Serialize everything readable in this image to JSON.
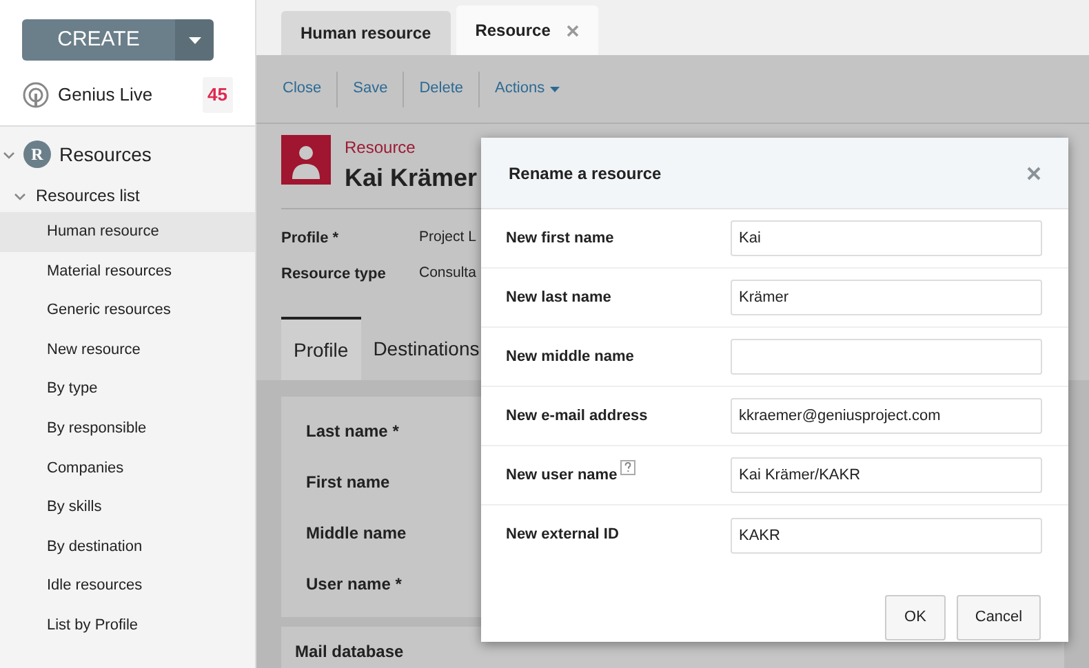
{
  "sidebar": {
    "create_label": "CREATE",
    "live": {
      "label": "Genius Live",
      "count": "45"
    },
    "section": {
      "letter": "R",
      "label": "Resources",
      "expanded": true,
      "group": {
        "label": "Resources list",
        "expanded": true,
        "items": [
          {
            "label": "Human resource",
            "selected": true
          },
          {
            "label": "Material resources",
            "selected": false
          },
          {
            "label": "Generic resources",
            "selected": false
          },
          {
            "label": "New resource",
            "selected": false
          },
          {
            "label": "By type",
            "selected": false
          },
          {
            "label": "By responsible",
            "selected": false
          },
          {
            "label": "Companies",
            "selected": false
          },
          {
            "label": "By skills",
            "selected": false
          },
          {
            "label": "By destination",
            "selected": false
          },
          {
            "label": "Idle resources",
            "selected": false
          },
          {
            "label": "List by Profile",
            "selected": false
          }
        ]
      }
    }
  },
  "tabs": [
    {
      "label": "Human resource",
      "selected": false,
      "closable": false
    },
    {
      "label": "Resource",
      "selected": true,
      "closable": true
    }
  ],
  "toolbar": [
    "Close",
    "Save",
    "Delete",
    "Actions"
  ],
  "record": {
    "type": "Resource",
    "name": "Kai Krämer",
    "fields": [
      {
        "label": "Profile *",
        "value": "Project L"
      },
      {
        "label": "Resource type",
        "value": "Consulta"
      }
    ],
    "subtabs": [
      {
        "label": "Profile",
        "selected": true
      },
      {
        "label": "Destinations",
        "selected": false
      }
    ],
    "form_fields": [
      "Last name *",
      "First name",
      "Middle name",
      "User name *"
    ],
    "next_section": "Mail database"
  },
  "dialog": {
    "title": "Rename a resource",
    "fields": [
      {
        "label": "New first name",
        "value": "Kai",
        "help": false
      },
      {
        "label": "New last name",
        "value": "Krämer",
        "help": false
      },
      {
        "label": "New middle name",
        "help": false
      },
      {
        "label": "New e-mail address",
        "value": "kkraemer@geniusproject.com",
        "help": false
      },
      {
        "label": "New user name",
        "value": "Kai Krämer/KAKR",
        "help": true
      },
      {
        "label": "New external ID",
        "value": "KAKR",
        "help": false
      }
    ],
    "buttons": [
      "OK",
      "Cancel"
    ]
  }
}
